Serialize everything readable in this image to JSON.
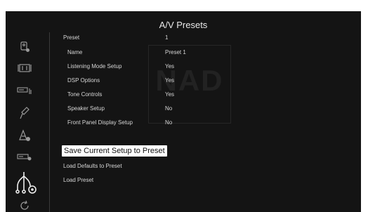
{
  "screen": {
    "title": "A/V Presets",
    "watermark": "NAD"
  },
  "sidebar": {
    "items": [
      {
        "icon": "source-input-icon"
      },
      {
        "icon": "video-display-icon"
      },
      {
        "icon": "audio-device-icon"
      },
      {
        "icon": "microphone-icon"
      },
      {
        "icon": "speaker-settings-icon"
      },
      {
        "icon": "receiver-settings-icon"
      },
      {
        "icon": "av-presets-icon",
        "active": true
      },
      {
        "icon": "refresh-icon"
      }
    ]
  },
  "presets": {
    "header": {
      "label": "Preset",
      "value": "1"
    },
    "rows": [
      {
        "label": "Name",
        "value": "Preset 1"
      },
      {
        "label": "Listening Mode Setup",
        "value": "Yes"
      },
      {
        "label": "DSP Options",
        "value": "Yes"
      },
      {
        "label": "Tone Controls",
        "value": "Yes"
      },
      {
        "label": "Speaker Setup",
        "value": "No"
      },
      {
        "label": "Front Panel Display Setup",
        "value": "No"
      }
    ],
    "actions": [
      {
        "label": "Save Current Setup to Preset",
        "selected": true
      },
      {
        "label": "Load Defaults to Preset"
      },
      {
        "label": "Load Preset"
      }
    ]
  },
  "colors": {
    "background": "#141414",
    "text": "#d6d6d6",
    "highlight": "#ffffff"
  }
}
